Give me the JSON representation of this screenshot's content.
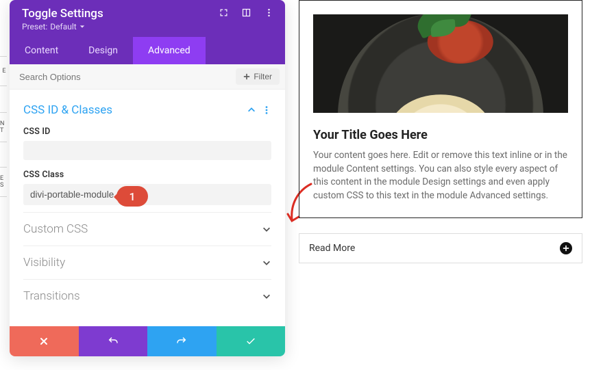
{
  "slivers": {
    "s1": "E",
    "s2": "N T",
    "s3": "E S"
  },
  "panel": {
    "title": "Toggle Settings",
    "preset_label": "Preset:",
    "preset_value": "Default",
    "tabs": {
      "content": "Content",
      "design": "Design",
      "advanced": "Advanced"
    },
    "search_placeholder": "Search Options",
    "filter_label": "Filter",
    "sections": {
      "css_id_classes": {
        "title": "CSS ID & Classes",
        "css_id_label": "CSS ID",
        "css_id_value": "",
        "css_class_label": "CSS Class",
        "css_class_value": "divi-portable-module"
      },
      "custom_css": "Custom CSS",
      "visibility": "Visibility",
      "transitions": "Transitions"
    },
    "callout_num": "1"
  },
  "preview": {
    "title": "Your Title Goes Here",
    "body": "Your content goes here. Edit or remove this text inline or in the module Content settings. You can also style every aspect of this content in the module Design settings and even apply custom CSS to this text in the module Advanced settings.",
    "readmore_label": "Read More"
  }
}
